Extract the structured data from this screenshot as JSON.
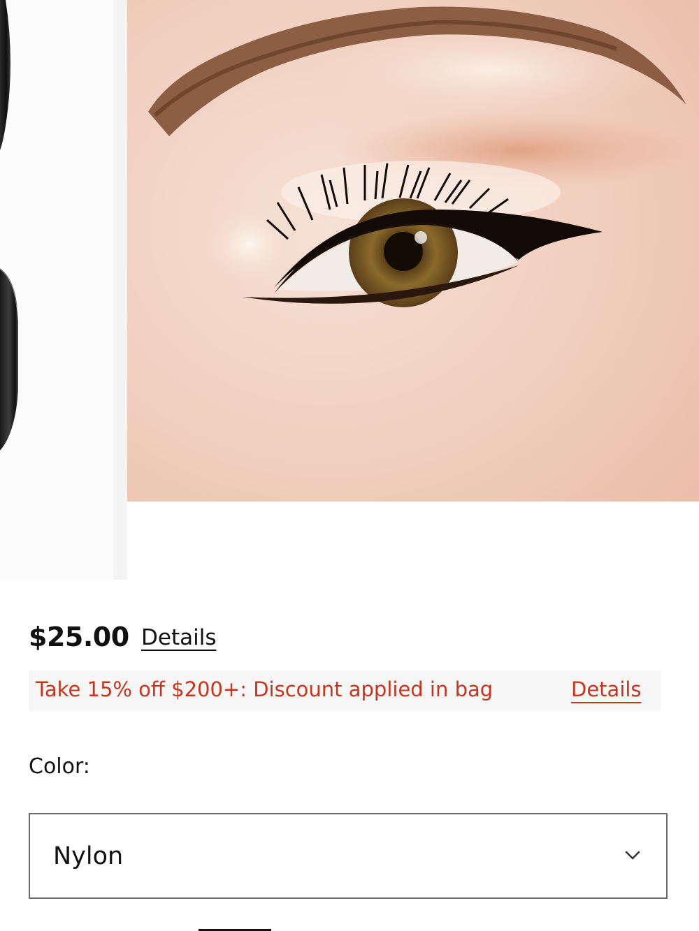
{
  "product": {
    "price": "$25.00",
    "price_details_label": "Details"
  },
  "promo": {
    "text": "Take 15% off $200+: Discount applied in bag",
    "details_label": "Details",
    "color": "#c8351c"
  },
  "color_selector": {
    "label": "Color:",
    "selected_value": "Nylon",
    "icon": "chevron-down-icon"
  },
  "gallery": {
    "images": [
      {
        "name": "product-thumbnail"
      },
      {
        "name": "eye-makeup-model-image"
      }
    ]
  }
}
